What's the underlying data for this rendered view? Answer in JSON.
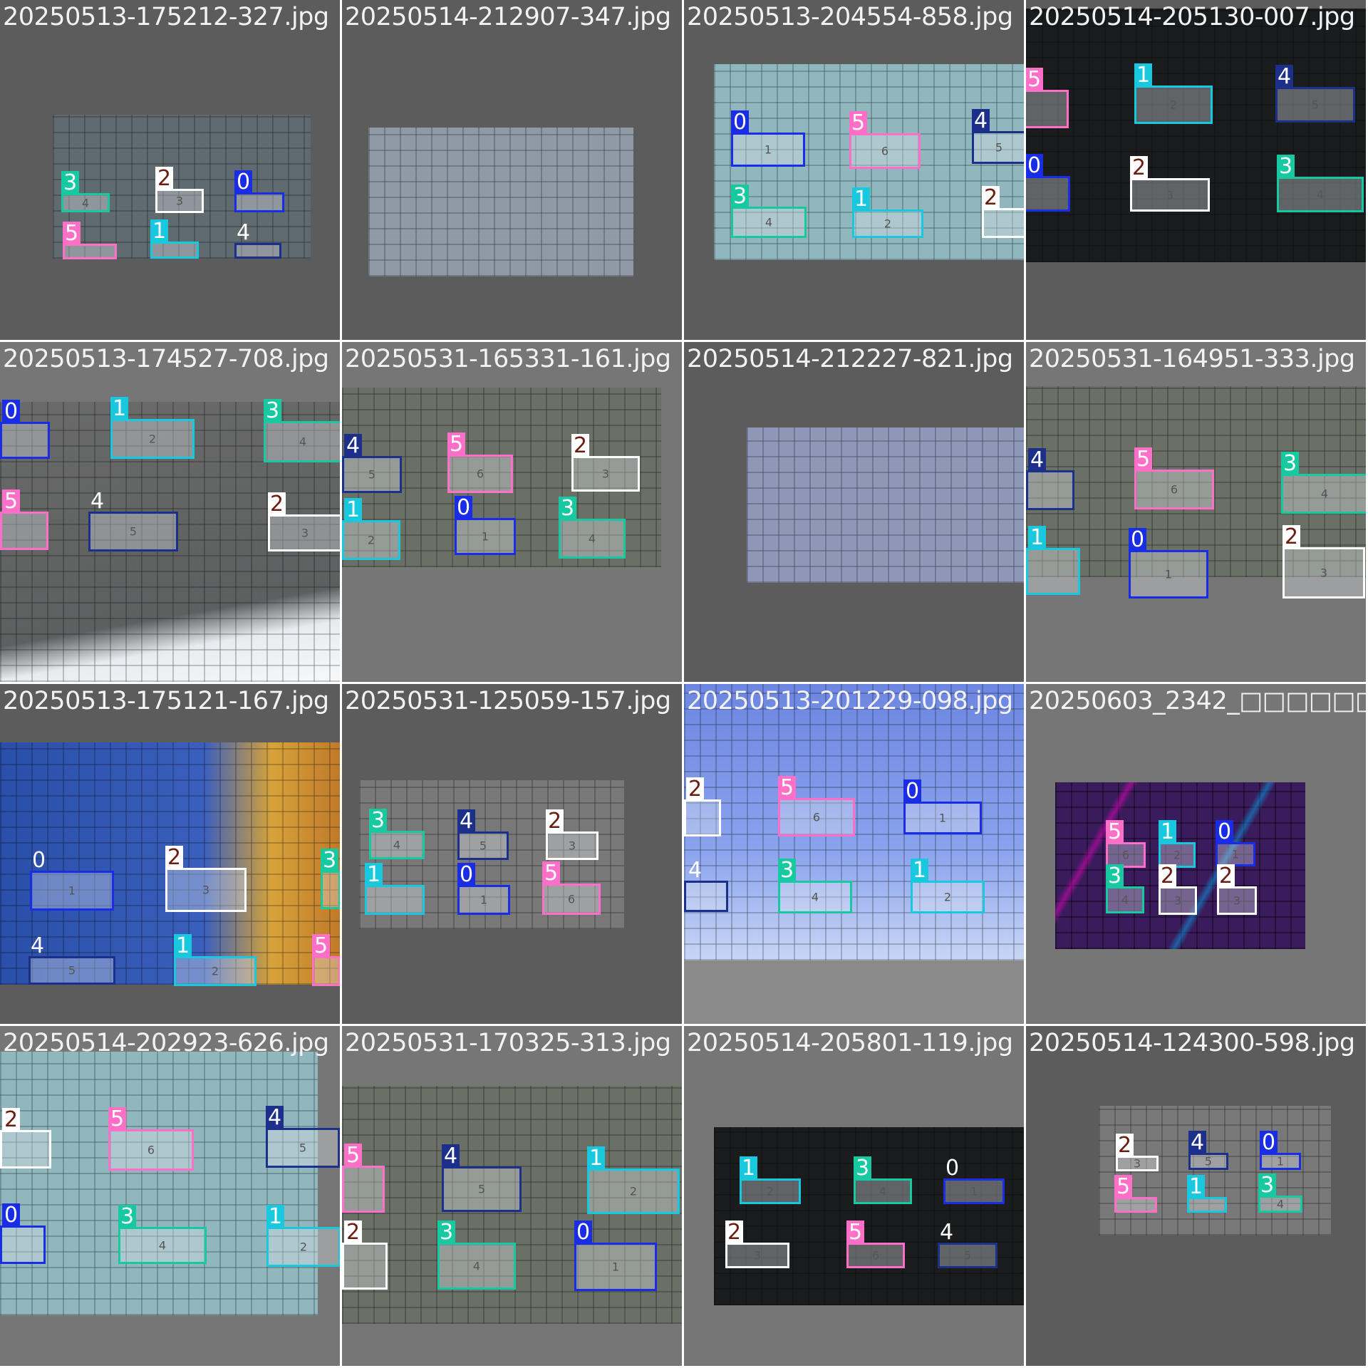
{
  "colors": {
    "0": "#1a2de6",
    "1": "#18c8df",
    "2": "#ffffff",
    "3": "#17c9a1",
    "4": "#1c2f8a",
    "5": "#ff6fc7"
  },
  "tag_text_colors": {
    "0": "#ffffff",
    "1": "#ffffff",
    "2": "#6b1d10",
    "3": "#ffffff",
    "4": "#ffffff",
    "5": "#ffffff"
  },
  "tiles": [
    {
      "title": "20250513-175212-327.jpg",
      "bg": "#5c5c5c"
    },
    {
      "title": "20250514-212907-347.jpg",
      "bg": "#5c5c5c"
    },
    {
      "title": "20250513-204554-858.jpg",
      "bg": "#5c5c5c"
    },
    {
      "title": "20250514-205130-007.jpg",
      "bg": "#5c5c5c"
    },
    {
      "title": "20250513-174527-708.jpg",
      "bg": "#767676"
    },
    {
      "title": "20250531-165331-161.jpg",
      "bg": "#767676"
    },
    {
      "title": "20250514-212227-821.jpg",
      "bg": "#5c5c5c"
    },
    {
      "title": "20250531-164951-333.jpg",
      "bg": "#767676"
    },
    {
      "title": "20250513-175121-167.jpg",
      "bg": "#5c5c5c"
    },
    {
      "title": "20250531-125059-157.jpg",
      "bg": "#5c5c5c"
    },
    {
      "title": "20250513-201229-098.jpg",
      "bg": "#8a8a8a"
    },
    {
      "title": "20250603_2342_□□□□□□□",
      "bg": "#767676"
    },
    {
      "title": "20250514-202923-626.jpg",
      "bg": "#767676"
    },
    {
      "title": "20250531-170325-313.jpg",
      "bg": "#767676"
    },
    {
      "title": "20250514-205801-119.jpg",
      "bg": "#767676"
    },
    {
      "title": "20250514-124300-598.jpg",
      "bg": "#5c5c5c"
    }
  ]
}
